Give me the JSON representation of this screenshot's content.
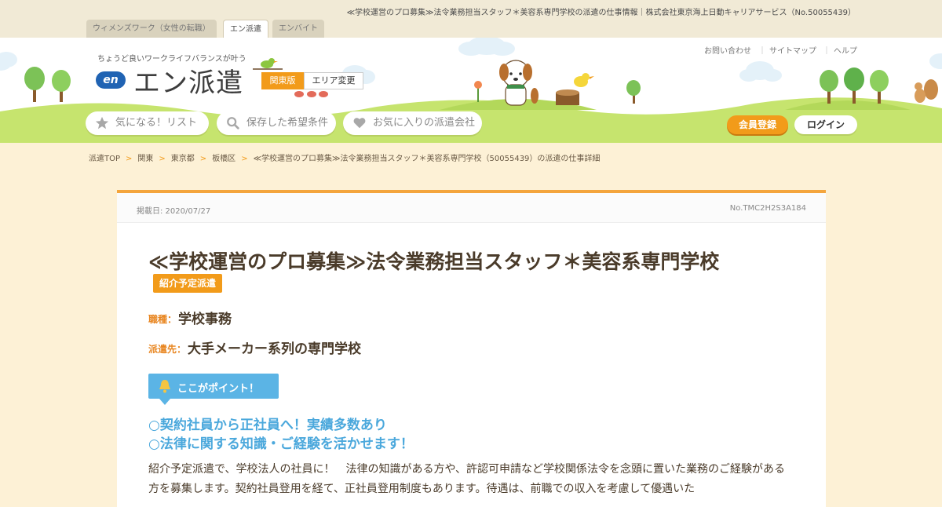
{
  "page_heading": "≪学校運営のプロ募集≫法令業務担当スタッフ＊美容系専門学校の派遣の仕事情報｜株式会社東京海上日動キャリアサービス（No.50055439）",
  "site_tabs": [
    {
      "label": "ウィメンズワーク（女性の転職）",
      "active": false
    },
    {
      "label": "エン派遣",
      "active": true
    },
    {
      "label": "エンバイト",
      "active": false
    }
  ],
  "header": {
    "tagline": "ちょうど良いワークライフバランスが叶う",
    "logo_badge": "en",
    "logo_text": "エン派遣",
    "region": "関東版",
    "region_change": "エリア変更",
    "util_links": [
      "お問い合わせ",
      "サイトマップ",
      "ヘルプ"
    ],
    "util_sep": "｜",
    "nav": {
      "watchlist": "気になる！リスト",
      "saved_conditions": "保存した希望条件",
      "favorite_agencies": "お気に入りの派遣会社"
    },
    "register": "会員登録",
    "login": "ログイン"
  },
  "breadcrumb": {
    "items": [
      "派遣TOP",
      "関東",
      "東京都",
      "板橋区",
      "≪学校運営のプロ募集≫法令業務担当スタッフ＊美容系専門学校（50055439）の派遣の仕事詳細"
    ],
    "separator": ">"
  },
  "job": {
    "posted": "掲載日: 2020/07/27",
    "number": "No.TMC2H2S3A184",
    "title": "≪学校運営のプロ募集≫法令業務担当スタッフ＊美容系専門学校",
    "tag": "紹介予定派遣",
    "category_label": "職種：",
    "category": "学校事務",
    "employer_label": "派遣先：",
    "employer": "大手メーカー系列の専門学校",
    "point_label": "ここがポイント！",
    "highlights": [
      "○契約社員から正社員へ！実績多数あり",
      "○法律に関する知識・ご経験を活かせます！"
    ],
    "description": "紹介予定派遣で、学校法人の社員に！　法律の知識がある方や、許認可申請など学校関係法令を念頭に置いた業務のご経験がある方を募集します。契約社員登用を経て、正社員登用制度もあります。待遇は、前職での収入を考慮して優遇いた"
  },
  "colors": {
    "accent_orange": "#f29b1a",
    "point_blue": "#5bb4e5",
    "highlight_blue": "#4ba8dc",
    "ground_green": "#c6e46e",
    "page_bg": "#fdf1d6"
  },
  "icons": [
    "star-icon",
    "search-icon",
    "heart-icon",
    "bell-icon",
    "bird-icon",
    "dog-icon",
    "squirrel-icon",
    "tree-icon",
    "cloud-icon"
  ]
}
